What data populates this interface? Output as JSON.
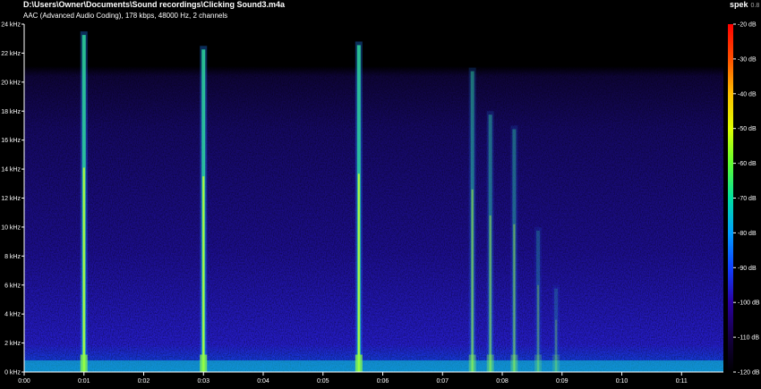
{
  "window": {
    "file_path": "D:\\Users\\Owner\\Documents\\Sound recordings\\Clicking Sound3.m4a",
    "info": "AAC (Advanced Audio Coding), 178 kbps, 48000 Hz, 2 channels",
    "app_name": "spek",
    "version": "0.8"
  },
  "frequency_axis": {
    "labels": [
      "0 kHz",
      "2 kHz",
      "4 kHz",
      "6 kHz",
      "8 kHz",
      "10 kHz",
      "12 kHz",
      "14 kHz",
      "16 kHz",
      "18 kHz",
      "20 kHz",
      "22 kHz",
      "24 kHz"
    ],
    "values_khz": [
      0,
      2,
      4,
      6,
      8,
      10,
      12,
      14,
      16,
      18,
      20,
      22,
      24
    ]
  },
  "time_axis": {
    "labels": [
      "0:00",
      "0:01",
      "0:02",
      "0:03",
      "0:04",
      "0:05",
      "0:06",
      "0:07",
      "0:08",
      "0:09",
      "0:10",
      "0:11"
    ],
    "values_s": [
      0,
      1,
      2,
      3,
      4,
      5,
      6,
      7,
      8,
      9,
      10,
      11
    ],
    "duration_s": 11.7
  },
  "level_axis": {
    "labels": [
      "-20 dB",
      "-30 dB",
      "-40 dB",
      "-50 dB",
      "-60 dB",
      "-70 dB",
      "-80 dB",
      "-90 dB",
      "-100 dB",
      "-110 dB",
      "-120 dB"
    ],
    "values_db": [
      -20,
      -30,
      -40,
      -50,
      -60,
      -70,
      -80,
      -90,
      -100,
      -110,
      -120
    ],
    "colors": [
      "#000000",
      "#150040",
      "#2a00a0",
      "#1040ff",
      "#00a0ff",
      "#00e0a0",
      "#60ff30",
      "#e0ff00",
      "#ffc000",
      "#ff5000",
      "#ff0000"
    ]
  },
  "spectrogram": {
    "clicks": [
      {
        "time_s": 1.0,
        "top_khz": 23.5,
        "strength": 1.0
      },
      {
        "time_s": 3.0,
        "top_khz": 22.5,
        "strength": 1.0
      },
      {
        "time_s": 5.6,
        "top_khz": 22.8,
        "strength": 1.0
      },
      {
        "time_s": 7.5,
        "top_khz": 21.0,
        "strength": 0.55
      },
      {
        "time_s": 7.8,
        "top_khz": 18.0,
        "strength": 0.5
      },
      {
        "time_s": 8.2,
        "top_khz": 17.0,
        "strength": 0.45
      },
      {
        "time_s": 8.6,
        "top_khz": 10.0,
        "strength": 0.3
      },
      {
        "time_s": 8.9,
        "top_khz": 6.0,
        "strength": 0.25
      }
    ]
  }
}
